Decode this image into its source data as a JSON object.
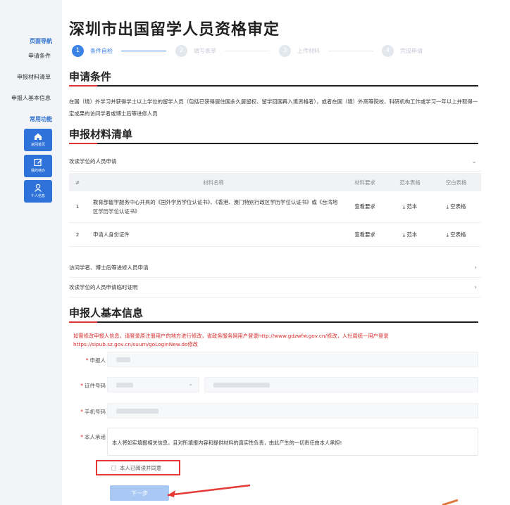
{
  "page_title": "深圳市出国留学人员资格审定",
  "steps": [
    {
      "num": "1",
      "label": "条件自检"
    },
    {
      "num": "2",
      "label": "填写表单"
    },
    {
      "num": "3",
      "label": "上传材料"
    },
    {
      "num": "4",
      "label": "完成申请"
    }
  ],
  "sidebar": {
    "nav_title": "页面导航",
    "nav_items": [
      "申请条件",
      "申报材料清单",
      "申报人基本信息"
    ],
    "func_title": "常用功能",
    "func_buttons": [
      {
        "label": "返回首页",
        "icon": "home-icon"
      },
      {
        "label": "我的待办",
        "icon": "edit-icon"
      },
      {
        "label": "个人信息",
        "icon": "user-icon"
      }
    ]
  },
  "sections": {
    "conditions_title": "申请条件",
    "conditions_text": "在国（境）外学习并获得学士以上学位的留学人员（包括已获得居住国永久居留权、留学回国再入境资格者），或者在国（境）外高等院校、科研机构工作或学习一年以上并取得一定成果的访问学者或博士后等进修人员",
    "materials_title": "申报材料清单",
    "applicant_title": "申报人基本信息"
  },
  "materials": {
    "group1": "攻读学位的人员申请",
    "headers": [
      "#",
      "材料名称",
      "材料要求",
      "范本表格",
      "空白表格"
    ],
    "rows": [
      {
        "idx": "1",
        "name": "教育部留学服务中心开具的《国外学历学位认证书》、《香港、澳门特别行政区学历学位认证书》或《台湾地区学历学位认证书》",
        "req": "查看要求",
        "tpl": "⤓ 范本",
        "blank": "⤓ 空表格"
      },
      {
        "idx": "2",
        "name": "申请人身份证件",
        "req": "查看要求",
        "tpl": "⤓ 范本",
        "blank": "⤓ 空表格"
      }
    ],
    "group2": "访问学者、博士后等进修人员申请",
    "group3": "攻读学位的人员申请临时证明"
  },
  "notice": "如需修改申报人信息，请登录原注册用户的地方进行修改，省政务服务网用户登录http://www.gdzwfw.gov.cn/修改，人社局统一用户登录https://sipub.sz.gov.cn/suum/goLoginNew.do修改",
  "form": {
    "applicant_label": "申报人",
    "id_label": "证件号码",
    "phone_label": "手机号码",
    "promise_label": "本人承诺",
    "promise_text": "本人将如实填报相关信息，且对所填报内容和提供材料的真实性负责，由此产生的一切责任由本人承担!",
    "agree_label": "本人已阅读并同意",
    "next_label": "下一步"
  },
  "colors": {
    "accent": "#3b82e6",
    "warning": "#d72b2b",
    "highlight_box": "#e53935"
  }
}
